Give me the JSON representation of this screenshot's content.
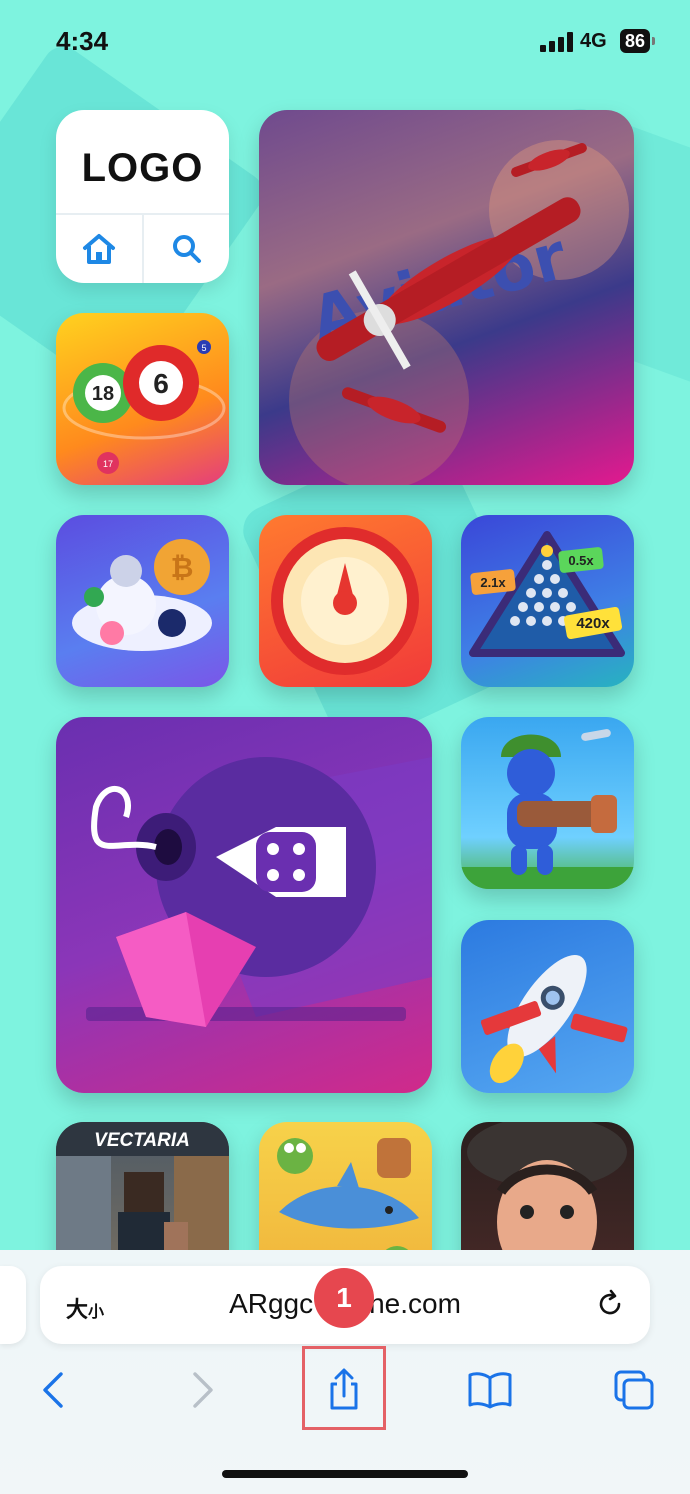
{
  "status_bar": {
    "time": "4:34",
    "network": "4G",
    "battery": "86"
  },
  "site": {
    "logo": "LOGO",
    "nav": [
      {
        "name": "home-icon"
      },
      {
        "name": "search-icon"
      }
    ]
  },
  "game_tiles": [
    {
      "name": "aviator-plane-game",
      "title_text": "Aviator"
    },
    {
      "name": "bingo-balls-game",
      "balls": [
        "18",
        "6",
        "5",
        "17"
      ]
    },
    {
      "name": "crypto-coins-game"
    },
    {
      "name": "wheel-of-fortune-game"
    },
    {
      "name": "plinko-game",
      "multipliers": [
        "2.1x",
        "0.5x",
        "420x"
      ]
    },
    {
      "name": "mines-dice-game"
    },
    {
      "name": "minigun-soldier-game"
    },
    {
      "name": "rocket-crash-game"
    },
    {
      "name": "vectaria-game",
      "title_text": "VECTARIA"
    },
    {
      "name": "frog-shark-game"
    },
    {
      "name": "scary-teacher-game"
    }
  ],
  "browser": {
    "text_size_label": "大",
    "text_size_small": "小",
    "url": "ARggc",
    "url_tail": "ne.com",
    "step_badge": "1",
    "toolbar": [
      "back-icon",
      "forward-icon",
      "share-icon",
      "bookmarks-icon",
      "tabs-icon"
    ]
  }
}
